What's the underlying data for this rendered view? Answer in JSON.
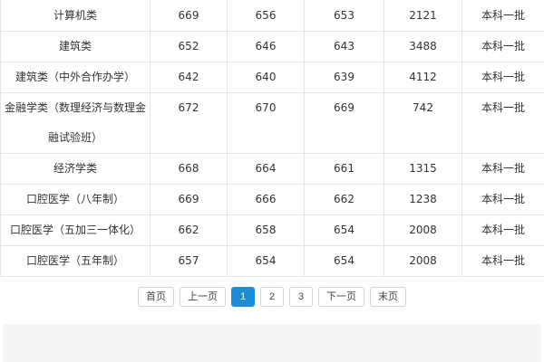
{
  "table": {
    "rows": [
      {
        "major": "计算机类",
        "s1": "669",
        "s2": "656",
        "s3": "653",
        "rank": "2121",
        "batch": "本科一批"
      },
      {
        "major": "建筑类",
        "s1": "652",
        "s2": "646",
        "s3": "643",
        "rank": "3488",
        "batch": "本科一批"
      },
      {
        "major": "建筑类（中外合作办学）",
        "s1": "642",
        "s2": "640",
        "s3": "639",
        "rank": "4112",
        "batch": "本科一批"
      },
      {
        "major": "金融学类（数理经济与数理金融试验班）",
        "s1": "672",
        "s2": "670",
        "s3": "669",
        "rank": "742",
        "batch": "本科一批"
      },
      {
        "major": "经济学类",
        "s1": "668",
        "s2": "664",
        "s3": "661",
        "rank": "1315",
        "batch": "本科一批"
      },
      {
        "major": "口腔医学（八年制）",
        "s1": "669",
        "s2": "666",
        "s3": "662",
        "rank": "1238",
        "batch": "本科一批"
      },
      {
        "major": "口腔医学（五加三一体化）",
        "s1": "662",
        "s2": "658",
        "s3": "654",
        "rank": "2008",
        "batch": "本科一批"
      },
      {
        "major": "口腔医学（五年制）",
        "s1": "657",
        "s2": "654",
        "s3": "654",
        "rank": "2008",
        "batch": "本科一批"
      }
    ]
  },
  "pagination": {
    "first": "首页",
    "prev": "上一页",
    "pages": [
      "1",
      "2",
      "3"
    ],
    "current": "1",
    "next": "下一页",
    "last": "末页"
  },
  "colors": {
    "accent": "#1a8cd8",
    "border": "#e4e4e4",
    "footer_bg": "#f4f4f4"
  }
}
